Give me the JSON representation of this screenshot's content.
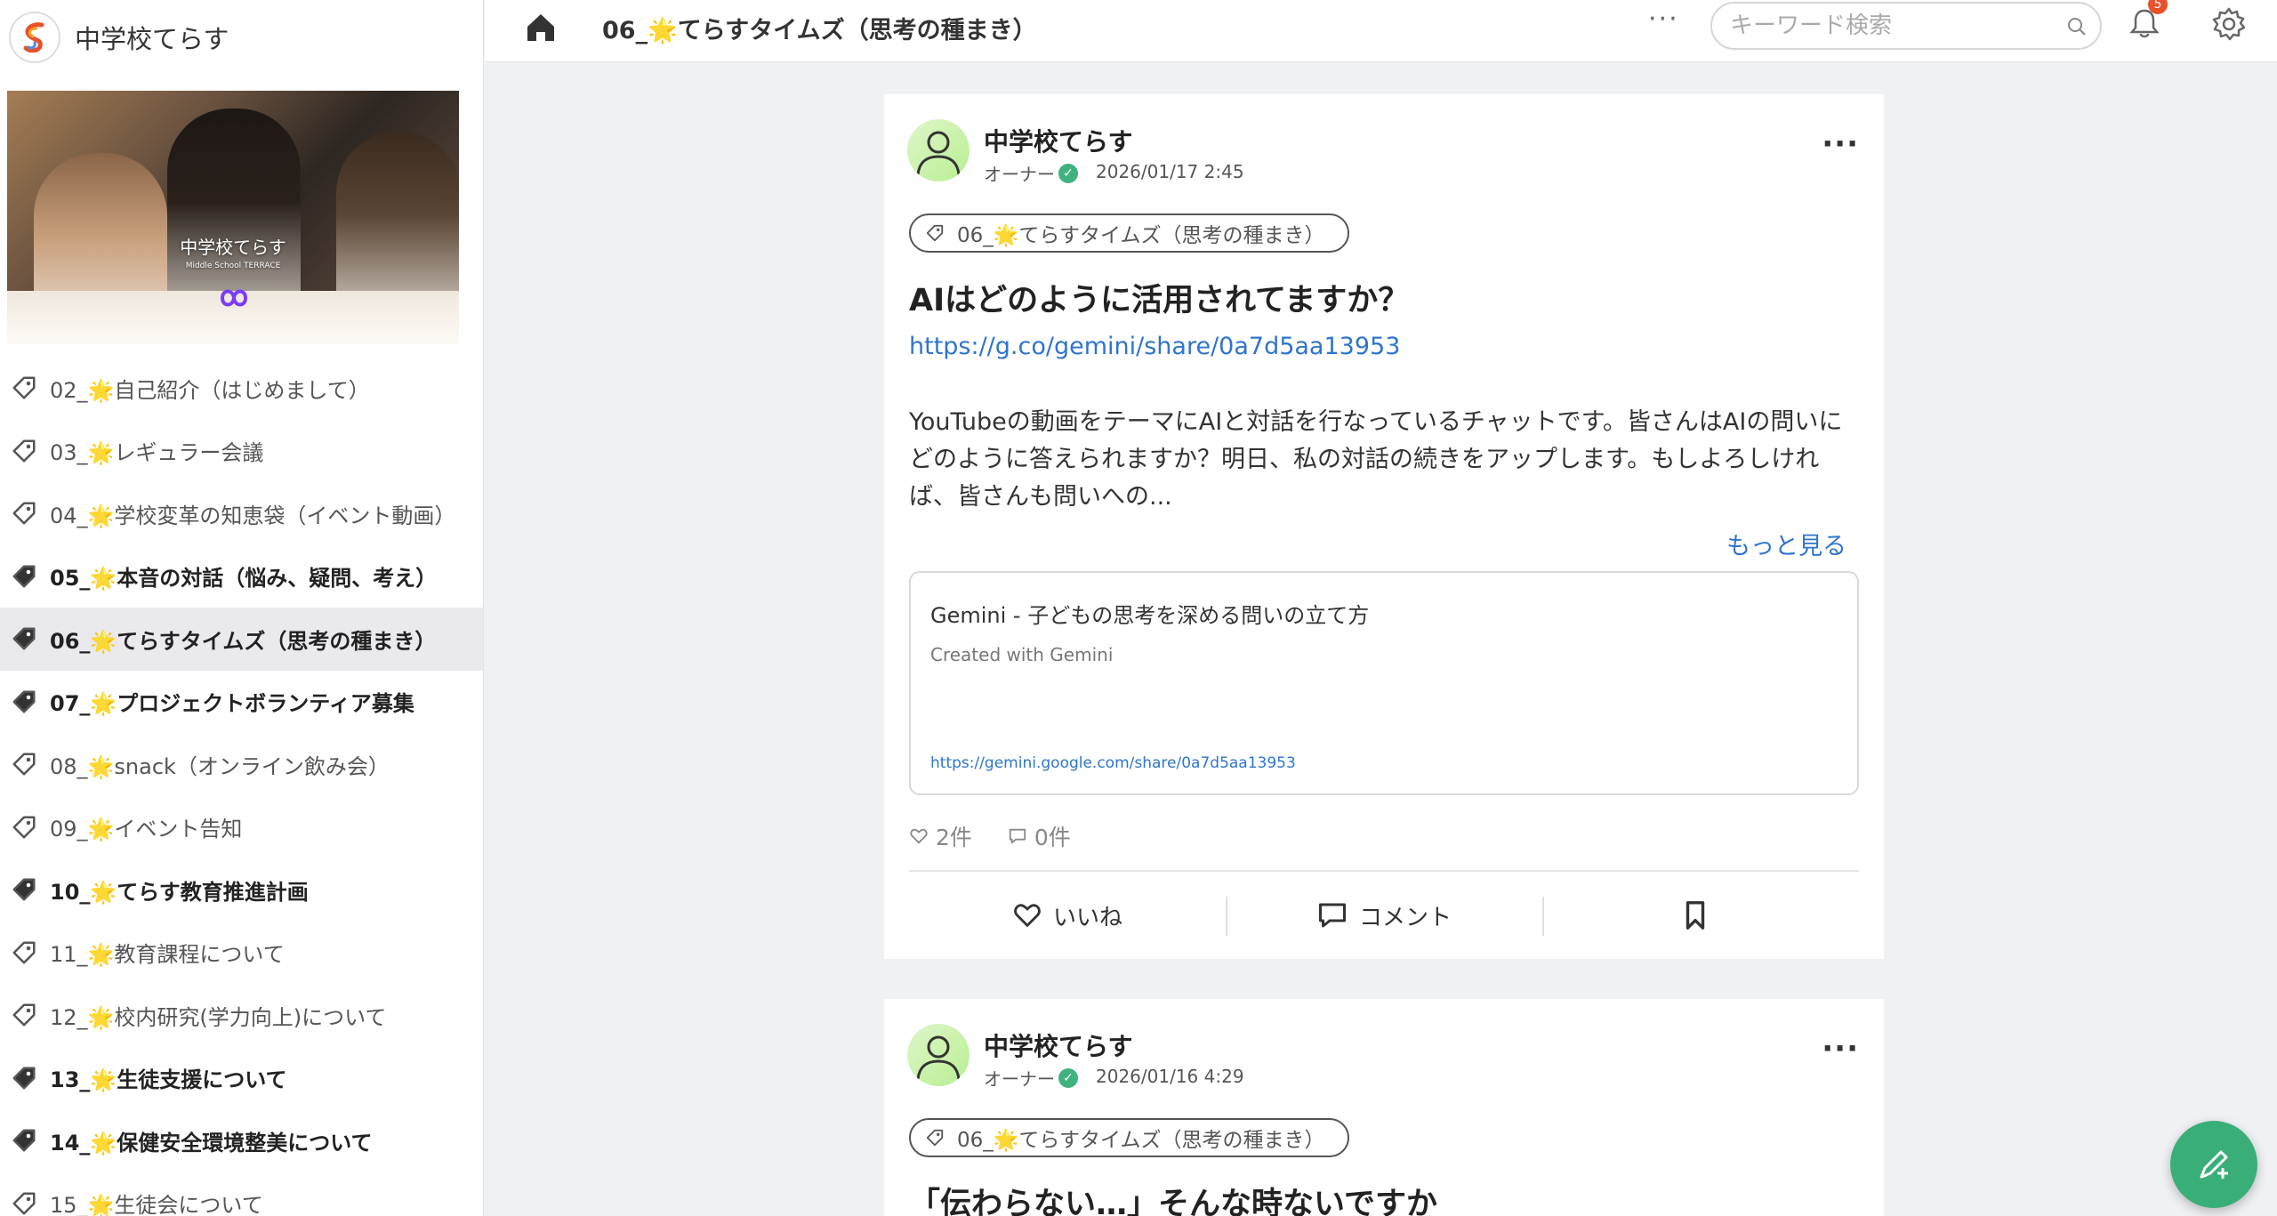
{
  "brand": {
    "name": "中学校てらす"
  },
  "banner": {
    "title": "中学校てらす",
    "subtitle": "Middle School TERRACE"
  },
  "sidebar": {
    "items": [
      {
        "label": "02_🌟自己紹介（はじめまして）",
        "bold": false,
        "active": false
      },
      {
        "label": "03_🌟レギュラー会議",
        "bold": false,
        "active": false
      },
      {
        "label": "04_🌟学校変革の知恵袋（イベント動画）",
        "bold": false,
        "active": false
      },
      {
        "label": "05_🌟本音の対話（悩み、疑問、考え）",
        "bold": true,
        "active": false
      },
      {
        "label": "06_🌟てらすタイムズ（思考の種まき）",
        "bold": true,
        "active": true
      },
      {
        "label": "07_🌟プロジェクトボランティア募集",
        "bold": true,
        "active": false
      },
      {
        "label": "08_🌟snack（オンライン飲み会）",
        "bold": false,
        "active": false
      },
      {
        "label": "09_🌟イベント告知",
        "bold": false,
        "active": false
      },
      {
        "label": "10_🌟てらす教育推進計画",
        "bold": true,
        "active": false
      },
      {
        "label": "11_🌟教育課程について",
        "bold": false,
        "active": false
      },
      {
        "label": "12_🌟校内研究(学力向上)について",
        "bold": false,
        "active": false
      },
      {
        "label": "13_🌟生徒支援について",
        "bold": true,
        "active": false
      },
      {
        "label": "14_🌟保健安全環境整美について",
        "bold": true,
        "active": false
      },
      {
        "label": "15_🌟生徒会について",
        "bold": false,
        "active": false
      }
    ]
  },
  "header": {
    "title": "06_🌟てらすタイムズ（思考の種まき）",
    "more": "···",
    "search_placeholder": "キーワード検索",
    "notification_count": "5"
  },
  "posts": [
    {
      "author": "中学校てらす",
      "role": "オーナー",
      "date": "2026/01/17 2:45",
      "tag": "06_🌟てらすタイムズ（思考の種まき）",
      "title": "AIはどのように活用されてますか？",
      "link": "https://g.co/gemini/share/0a7d5aa13953",
      "body": "YouTubeの動画をテーマにAIと対話を行なっているチャットです。皆さんはAIの問いにどのように答えられますか？明日、私の対話の続きをアップします。もしよろしければ、皆さんも問いへの...",
      "see_more": "もっと見る",
      "card": {
        "title": "Gemini - 子どもの思考を深める問いの立て方",
        "description": "Created with Gemini",
        "url": "https://gemini.google.com/share/0a7d5aa13953"
      },
      "likes": "2件",
      "comments": "0件",
      "like_label": "いいね",
      "comment_label": "コメント"
    },
    {
      "author": "中学校てらす",
      "role": "オーナー",
      "date": "2026/01/16 4:29",
      "tag": "06_🌟てらすタイムズ（思考の種まき）",
      "title": "「伝わらない…」そんな時ないですか"
    }
  ],
  "colors": {
    "accent": "#3aae78",
    "link": "#2f74cf",
    "badge": "#e8522a"
  }
}
